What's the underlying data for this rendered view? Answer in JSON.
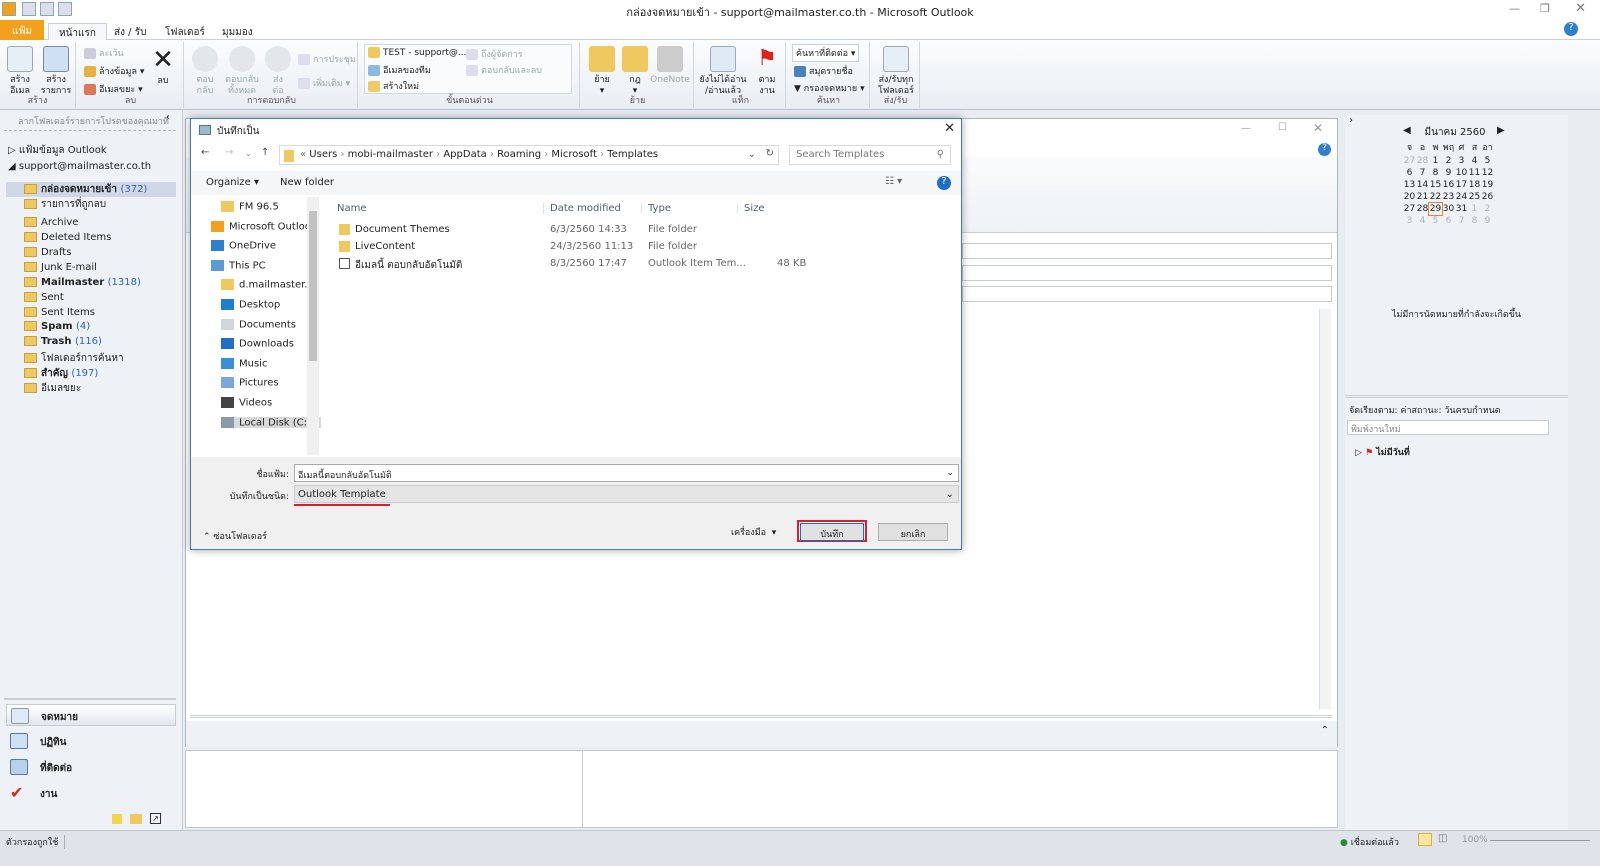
{
  "window": {
    "title": "กล่องจดหมายเข้า - support@mailmaster.co.th  -  Microsoft Outlook"
  },
  "tabs": [
    "แฟ้ม",
    "หน้าแรก",
    "ส่ง / รับ",
    "โฟลเดอร์",
    "มุมมอง"
  ],
  "ribbon": {
    "new": {
      "new_email": "สร้าง\nอีเมล",
      "new_items": "สร้าง\nรายการ",
      "label": "สร้าง"
    },
    "delete": {
      "ignore": "ละเว้น",
      "clean_up": "ล้างข้อมูล",
      "junk": "อีเมลขยะ",
      "delete": "ลบ",
      "label": "ลบ"
    },
    "respond": {
      "reply": "ตอบ\nกลับ",
      "reply_all": "ตอบกลับ\nทั้งหมด",
      "forward": "ส่ง\nต่อ",
      "meeting": "การประชุม",
      "more": "เพิ่มเติม",
      "label": "การตอบกลับ"
    },
    "quick_steps": {
      "items": [
        "TEST - support@...",
        "อีเมลของทีม",
        "สร้างใหม่",
        "ถึงผู้จัดการ",
        "ตอบกลับและลบ"
      ],
      "label": "ขั้นตอนด่วน"
    },
    "move": {
      "move": "ย้าย",
      "rules": "กฎ",
      "onenote": "OneNote",
      "label": "ย้าย"
    },
    "tags": {
      "unread": "ยังไม่ได้อ่าน\n/อ่านแล้ว",
      "follow_up": "ตาม\nงาน",
      "label": "แท็ก"
    },
    "find": {
      "contact_search": "ค้นหาที่ติดต่อ",
      "address_book": "สมุดรายชื่อ",
      "filter": "กรองจดหมาย",
      "label": "ค้นหา"
    },
    "send_receive": {
      "all": "ส่ง/รับทุก\nโฟลเดอร์",
      "label": "ส่ง/รับ"
    }
  },
  "nav": {
    "favorites_hint": "ลากโฟลเดอร์รายการโปรดของคุณมาที่",
    "data_file": "แฟ้มข้อมูล Outlook",
    "account": "support@mailmaster.co.th",
    "folders": [
      {
        "name": "กล่องจดหมายเข้า",
        "count": "(372)",
        "bold": true
      },
      {
        "name": "รายการที่ถูกลบ"
      },
      {
        "name": "Archive"
      },
      {
        "name": "Deleted Items"
      },
      {
        "name": "Drafts"
      },
      {
        "name": "Junk E-mail"
      },
      {
        "name": "Mailmaster",
        "count": "(1318)",
        "bold": true
      },
      {
        "name": "Sent"
      },
      {
        "name": "Sent Items"
      },
      {
        "name": "Spam",
        "count": "(4)",
        "bold": true
      },
      {
        "name": "Trash",
        "count": "(116)",
        "bold": true
      },
      {
        "name": "โฟลเดอร์การค้นหา"
      },
      {
        "name": "สำคัญ",
        "count": "(197)",
        "bold": true
      },
      {
        "name": "อีเมลขยะ"
      }
    ],
    "modules": [
      "จดหมาย",
      "ปฏิทิน",
      "ที่ติดต่อ",
      "งาน"
    ]
  },
  "todo": {
    "month": "มีนาคม 2560",
    "weekdays": [
      "จ",
      "อ",
      "พ",
      "พฤ",
      "ศ",
      "ส",
      "อา"
    ],
    "weeks": [
      [
        "27",
        "28",
        "1",
        "2",
        "3",
        "4",
        "5"
      ],
      [
        "6",
        "7",
        "8",
        "9",
        "10",
        "11",
        "12"
      ],
      [
        "13",
        "14",
        "15",
        "16",
        "17",
        "18",
        "19"
      ],
      [
        "20",
        "21",
        "22",
        "23",
        "24",
        "25",
        "26"
      ],
      [
        "27",
        "28",
        "29",
        "30",
        "31",
        "1",
        "2"
      ],
      [
        "3",
        "4",
        "5",
        "6",
        "7",
        "8",
        "9"
      ]
    ],
    "today": "29",
    "no_appointments": "ไม่มีการนัดหมายที่กำลังจะเกิดขึ้น",
    "arrange": "จัดเรียงตาม: ค่าสถานะ: วันครบกำหนด",
    "new_task_placeholder": "พิมพ์งานใหม่",
    "no_date": "ไม่มีวันที่"
  },
  "dialog": {
    "title": "บันทึกเป็น",
    "path": [
      "Users",
      "mobi-mailmaster",
      "AppData",
      "Roaming",
      "Microsoft",
      "Templates"
    ],
    "search_placeholder": "Search Templates",
    "organize": "Organize",
    "new_folder": "New folder",
    "tree": [
      "FM 96.5",
      "Microsoft Outlook",
      "OneDrive",
      "This PC",
      "d.mailmaster.co",
      "Desktop",
      "Documents",
      "Downloads",
      "Music",
      "Pictures",
      "Videos",
      "Local Disk (C:)"
    ],
    "columns": [
      "Name",
      "Date modified",
      "Type",
      "Size"
    ],
    "files": [
      {
        "name": "Document Themes",
        "date": "6/3/2560 14:33",
        "type": "File folder",
        "size": ""
      },
      {
        "name": "LiveContent",
        "date": "24/3/2560 11:13",
        "type": "File folder",
        "size": ""
      },
      {
        "name": "อีเมลนี้ ตอบกลับอัตโนมัติ",
        "date": "8/3/2560 17:47",
        "type": "Outlook Item Tem...",
        "size": "48 KB"
      }
    ],
    "filename_label": "ชื่อแฟ้ม:",
    "filename": "อีเมลนี้ตอบกลับอัตโนมัติ",
    "filetype_label": "บันทึกเป็นชนิด:",
    "filetype": "Outlook Template",
    "hide_folders": "ซ่อนโฟลเดอร์",
    "tools": "เครื่องมือ",
    "save": "บันทึก",
    "cancel": "ยกเลิก"
  },
  "status": {
    "filter": "ตัวกรองถูกใช้",
    "connected": "เชื่อมต่อแล้ว",
    "zoom": "100%"
  },
  "colors": {
    "accent": "#f3a11c",
    "highlight": "#d9202a",
    "link": "#2a63c3"
  }
}
